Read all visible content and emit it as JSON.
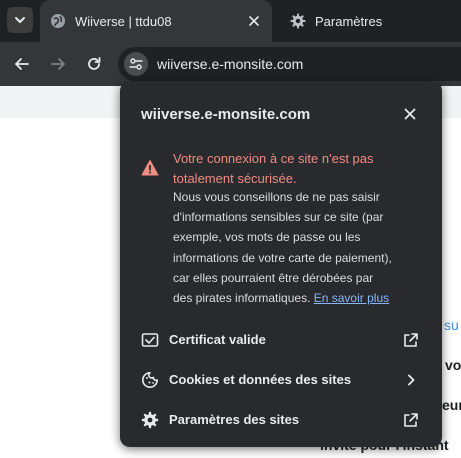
{
  "tabs": [
    {
      "title": "Wiiverse | ttdu08",
      "favicon": "globe-icon",
      "active": true
    },
    {
      "title": "Paramètres",
      "favicon": "gear-icon",
      "active": false
    }
  ],
  "address_bar": {
    "url": "wiiverse.e-monsite.com"
  },
  "popup": {
    "title": "wiiverse.e-monsite.com",
    "warning": {
      "title": "Votre connexion à ce site n'est pas totalement sécurisée.",
      "body": "Nous vous conseillons de ne pas saisir d'informations sensibles sur ce site (par exemple, vos mots de passe ou les informations de votre carte de paiement), car elles pourraient être dérobées par des pirates informatiques.",
      "link": "En savoir plus"
    },
    "items": [
      {
        "label": "Certificat valide",
        "icon": "certificate-icon",
        "trailing": "external-link-icon"
      },
      {
        "label": "Cookies et données des sites",
        "icon": "cookie-icon",
        "trailing": "chevron-right-icon"
      },
      {
        "label": "Paramètres des sites",
        "icon": "gear-icon",
        "trailing": "external-link-icon"
      }
    ]
  },
  "page_fragments": [
    "su",
    "vo",
    "eur",
    "invite pour l'instant"
  ],
  "colors": {
    "tabstrip_bg": "#202124",
    "toolbar_bg": "#35363a",
    "popup_bg": "#282a2d",
    "warning_red": "#f28b82",
    "link_blue": "#8ab4f8"
  }
}
